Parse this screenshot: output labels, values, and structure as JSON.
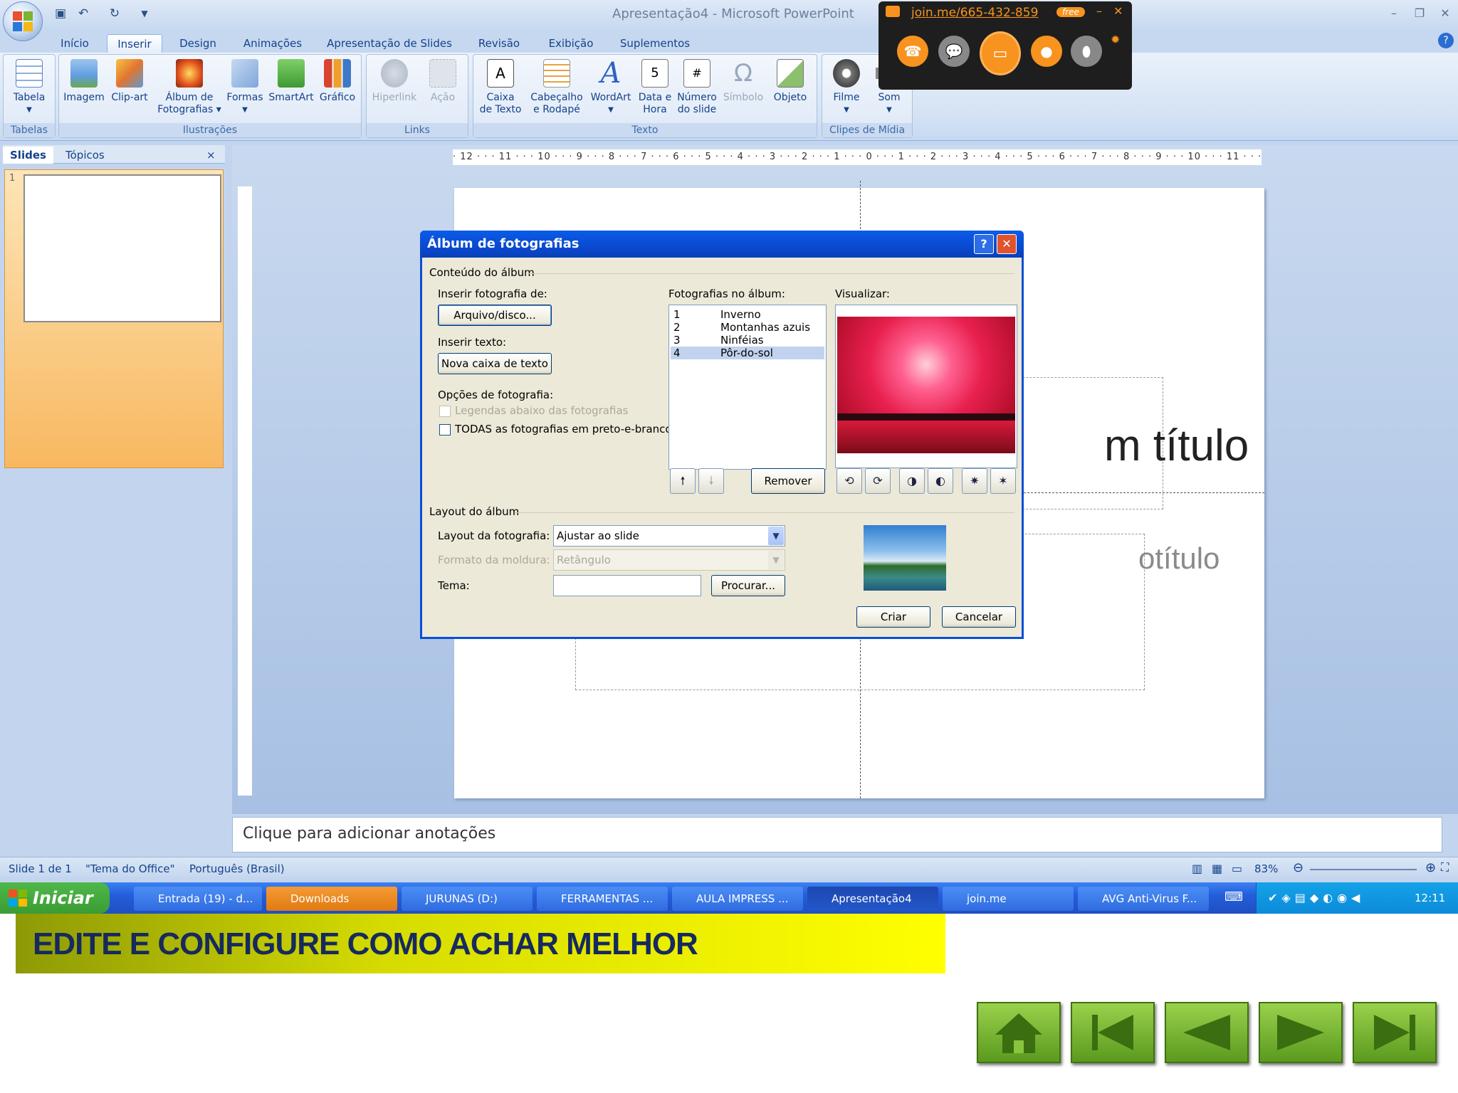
{
  "window": {
    "title": "Apresentação4 - Microsoft PowerPoint"
  },
  "ribbon": {
    "tabs": [
      "Início",
      "Inserir",
      "Design",
      "Animações",
      "Apresentação de Slides",
      "Revisão",
      "Exibição",
      "Suplementos"
    ],
    "active_tab": "Inserir",
    "groups": {
      "tabelas": {
        "label": "Tabelas",
        "tabela": "Tabela"
      },
      "ilustracoes": {
        "label": "Ilustrações",
        "imagem": "Imagem",
        "clipart": "Clip-art",
        "album1": "Álbum de",
        "album2": "Fotografias",
        "formas": "Formas",
        "smartart": "SmartArt",
        "grafico": "Gráfico"
      },
      "links": {
        "label": "Links",
        "hiperlink": "Hiperlink",
        "acao": "Ação"
      },
      "texto": {
        "label": "Texto",
        "caixa1": "Caixa",
        "caixa2": "de Texto",
        "cab1": "Cabeçalho",
        "cab2": "e Rodapé",
        "wordart": "WordArt",
        "data1": "Data e",
        "data2": "Hora",
        "num1": "Número",
        "num2": "do slide",
        "simbolo": "Símbolo",
        "objeto": "Objeto"
      },
      "midia": {
        "label": "Clipes de Mídia",
        "filme": "Filme",
        "som": "Som"
      }
    }
  },
  "joinme": {
    "link": "join.me/665-432-859",
    "badge": "free"
  },
  "left_pane": {
    "tab_slides": "Slides",
    "tab_topicos": "Tópicos",
    "slide_number": "1"
  },
  "ruler": {
    "h": "· 12 · · · 11 · · · 10 · · · 9 · · · 8 · · · 7 · · · 6 · · · 5 · · · 4 · · · 3 · · · 2 · · · 1 · · · 0 · · · 1 · · · 2 · · · 3 · · · 4 · · · 5 · · · 6 · · · 7 · · · 8 · · · 9 · · · 10 · · · 11 · · · 12 ·"
  },
  "slide": {
    "title_fragment": "m título",
    "subtitle_fragment": "otítulo"
  },
  "notes": {
    "placeholder": "Clique para adicionar anotações"
  },
  "status": {
    "slide": "Slide 1 de 1",
    "theme": "\"Tema do Office\"",
    "language": "Português (Brasil)",
    "zoom": "83%"
  },
  "dialog": {
    "title": "Álbum de fotografias",
    "content_section": "Conteúdo do álbum",
    "insert_photo_from": "Inserir fotografia de:",
    "file_button": "Arquivo/disco...",
    "insert_text": "Inserir texto:",
    "new_textbox_button": "Nova caixa de texto",
    "photo_options": "Opções de fotografia:",
    "captions_option": "Legendas abaixo das fotografias",
    "bw_option": "TODAS as fotografias em preto-e-branco",
    "photos_label": "Fotografias no álbum:",
    "photos": [
      {
        "n": "1",
        "name": "Inverno"
      },
      {
        "n": "2",
        "name": "Montanhas azuis"
      },
      {
        "n": "3",
        "name": "Ninféias"
      },
      {
        "n": "4",
        "name": "Pôr-do-sol"
      }
    ],
    "selected_index": 4,
    "preview_label": "Visualizar:",
    "remove_button": "Remover",
    "layout_section": "Layout do álbum",
    "photo_layout_label": "Layout da fotografia:",
    "photo_layout_value": "Ajustar ao slide",
    "frame_shape_label": "Formato da moldura:",
    "frame_shape_value": "Retângulo",
    "theme_label": "Tema:",
    "theme_value": "",
    "browse_button": "Procurar...",
    "create_button": "Criar",
    "cancel_button": "Cancelar"
  },
  "taskbar": {
    "start": "Iniciar",
    "tasks": [
      "Entrada (19) - d...",
      "Downloads",
      "JURUNAS (D:)",
      "FERRAMENTAS ...",
      "AULA IMPRESS ...",
      "Apresentação4",
      "join.me",
      "AVG Anti-Virus F..."
    ],
    "clock": "12:11"
  },
  "banner": {
    "text": "EDITE E CONFIGURE COMO ACHAR MELHOR"
  },
  "colors": {
    "dialog_title": "#0a4fd6",
    "banner": "#ffff00",
    "nav_green": "#7ab733",
    "joinme_orange": "#f7931e"
  }
}
